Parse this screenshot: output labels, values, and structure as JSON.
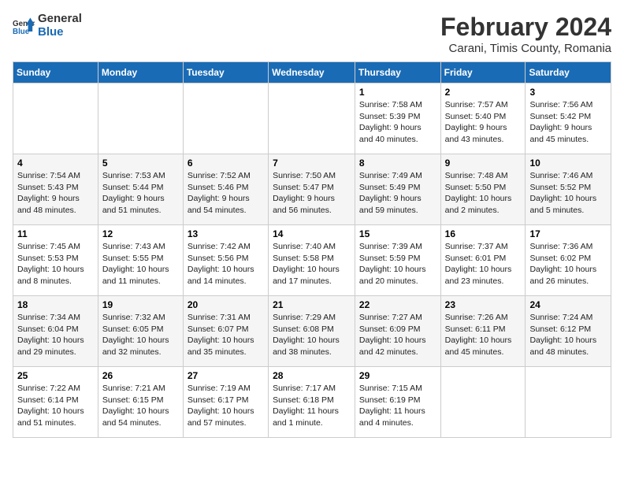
{
  "logo": {
    "text_general": "General",
    "text_blue": "Blue"
  },
  "title": "February 2024",
  "subtitle": "Carani, Timis County, Romania",
  "days_of_week": [
    "Sunday",
    "Monday",
    "Tuesday",
    "Wednesday",
    "Thursday",
    "Friday",
    "Saturday"
  ],
  "weeks": [
    [
      {
        "day": "",
        "info": ""
      },
      {
        "day": "",
        "info": ""
      },
      {
        "day": "",
        "info": ""
      },
      {
        "day": "",
        "info": ""
      },
      {
        "day": "1",
        "info": "Sunrise: 7:58 AM\nSunset: 5:39 PM\nDaylight: 9 hours and 40 minutes."
      },
      {
        "day": "2",
        "info": "Sunrise: 7:57 AM\nSunset: 5:40 PM\nDaylight: 9 hours and 43 minutes."
      },
      {
        "day": "3",
        "info": "Sunrise: 7:56 AM\nSunset: 5:42 PM\nDaylight: 9 hours and 45 minutes."
      }
    ],
    [
      {
        "day": "4",
        "info": "Sunrise: 7:54 AM\nSunset: 5:43 PM\nDaylight: 9 hours and 48 minutes."
      },
      {
        "day": "5",
        "info": "Sunrise: 7:53 AM\nSunset: 5:44 PM\nDaylight: 9 hours and 51 minutes."
      },
      {
        "day": "6",
        "info": "Sunrise: 7:52 AM\nSunset: 5:46 PM\nDaylight: 9 hours and 54 minutes."
      },
      {
        "day": "7",
        "info": "Sunrise: 7:50 AM\nSunset: 5:47 PM\nDaylight: 9 hours and 56 minutes."
      },
      {
        "day": "8",
        "info": "Sunrise: 7:49 AM\nSunset: 5:49 PM\nDaylight: 9 hours and 59 minutes."
      },
      {
        "day": "9",
        "info": "Sunrise: 7:48 AM\nSunset: 5:50 PM\nDaylight: 10 hours and 2 minutes."
      },
      {
        "day": "10",
        "info": "Sunrise: 7:46 AM\nSunset: 5:52 PM\nDaylight: 10 hours and 5 minutes."
      }
    ],
    [
      {
        "day": "11",
        "info": "Sunrise: 7:45 AM\nSunset: 5:53 PM\nDaylight: 10 hours and 8 minutes."
      },
      {
        "day": "12",
        "info": "Sunrise: 7:43 AM\nSunset: 5:55 PM\nDaylight: 10 hours and 11 minutes."
      },
      {
        "day": "13",
        "info": "Sunrise: 7:42 AM\nSunset: 5:56 PM\nDaylight: 10 hours and 14 minutes."
      },
      {
        "day": "14",
        "info": "Sunrise: 7:40 AM\nSunset: 5:58 PM\nDaylight: 10 hours and 17 minutes."
      },
      {
        "day": "15",
        "info": "Sunrise: 7:39 AM\nSunset: 5:59 PM\nDaylight: 10 hours and 20 minutes."
      },
      {
        "day": "16",
        "info": "Sunrise: 7:37 AM\nSunset: 6:01 PM\nDaylight: 10 hours and 23 minutes."
      },
      {
        "day": "17",
        "info": "Sunrise: 7:36 AM\nSunset: 6:02 PM\nDaylight: 10 hours and 26 minutes."
      }
    ],
    [
      {
        "day": "18",
        "info": "Sunrise: 7:34 AM\nSunset: 6:04 PM\nDaylight: 10 hours and 29 minutes."
      },
      {
        "day": "19",
        "info": "Sunrise: 7:32 AM\nSunset: 6:05 PM\nDaylight: 10 hours and 32 minutes."
      },
      {
        "day": "20",
        "info": "Sunrise: 7:31 AM\nSunset: 6:07 PM\nDaylight: 10 hours and 35 minutes."
      },
      {
        "day": "21",
        "info": "Sunrise: 7:29 AM\nSunset: 6:08 PM\nDaylight: 10 hours and 38 minutes."
      },
      {
        "day": "22",
        "info": "Sunrise: 7:27 AM\nSunset: 6:09 PM\nDaylight: 10 hours and 42 minutes."
      },
      {
        "day": "23",
        "info": "Sunrise: 7:26 AM\nSunset: 6:11 PM\nDaylight: 10 hours and 45 minutes."
      },
      {
        "day": "24",
        "info": "Sunrise: 7:24 AM\nSunset: 6:12 PM\nDaylight: 10 hours and 48 minutes."
      }
    ],
    [
      {
        "day": "25",
        "info": "Sunrise: 7:22 AM\nSunset: 6:14 PM\nDaylight: 10 hours and 51 minutes."
      },
      {
        "day": "26",
        "info": "Sunrise: 7:21 AM\nSunset: 6:15 PM\nDaylight: 10 hours and 54 minutes."
      },
      {
        "day": "27",
        "info": "Sunrise: 7:19 AM\nSunset: 6:17 PM\nDaylight: 10 hours and 57 minutes."
      },
      {
        "day": "28",
        "info": "Sunrise: 7:17 AM\nSunset: 6:18 PM\nDaylight: 11 hours and 1 minute."
      },
      {
        "day": "29",
        "info": "Sunrise: 7:15 AM\nSunset: 6:19 PM\nDaylight: 11 hours and 4 minutes."
      },
      {
        "day": "",
        "info": ""
      },
      {
        "day": "",
        "info": ""
      }
    ]
  ]
}
